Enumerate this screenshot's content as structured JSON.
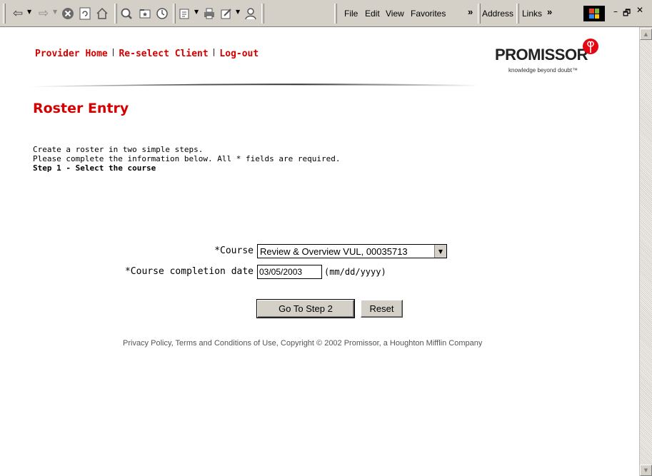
{
  "browser": {
    "menu": {
      "file": "File",
      "edit": "Edit",
      "view": "View",
      "favorites": "Favorites"
    },
    "address_label": "Address",
    "links_label": "Links",
    "more_glyph": "»"
  },
  "nav": {
    "provider_home": "Provider Home",
    "reselect_client": "Re-select Client",
    "logout": "Log-out",
    "separator": "|"
  },
  "logo": {
    "name": "PROMISSOR",
    "tagline": "knowledge beyond doubt™",
    "color": "#e30613"
  },
  "page": {
    "title": "Roster Entry",
    "intro_line1": "Create a roster in two simple steps.",
    "intro_line2": "Please complete the information below. All * fields are required.",
    "step": "Step 1 - Select the course"
  },
  "form": {
    "course_label": "*Course",
    "course_value": "Review & Overview VUL, 00035713",
    "date_label": "*Course completion date",
    "date_value": "03/05/2003",
    "date_format": "(mm/dd/yyyy)",
    "next_button": "Go To Step 2",
    "reset_button": "Reset"
  },
  "footer": {
    "text": "Privacy Policy, Terms and Conditions of Use,  Copyright © 2002 Promissor,  a Houghton Mifflin Company"
  },
  "colors": {
    "accent": "#d40000",
    "toolbar": "#d4d0c8"
  }
}
